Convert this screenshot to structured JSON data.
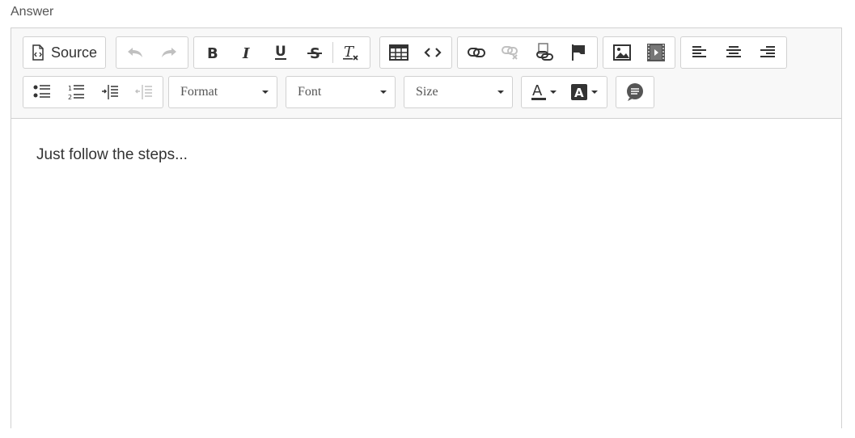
{
  "field": {
    "label": "Answer"
  },
  "toolbar": {
    "source_label": "Source",
    "buttons": {
      "source": "source-icon",
      "undo": "undo-icon",
      "redo": "redo-icon",
      "bold": "bold-icon",
      "italic": "italic-icon",
      "underline": "underline-icon",
      "strikethrough": "strikethrough-icon",
      "remove_format": "remove-format-icon",
      "table": "table-icon",
      "code": "code-icon",
      "link": "link-icon",
      "unlink": "unlink-icon",
      "anchor_link": "anchor-icon",
      "flag": "flag-icon",
      "image": "image-icon",
      "video": "video-icon",
      "align_left": "align-left-icon",
      "align_center": "align-center-icon",
      "align_right": "align-right-icon",
      "bulleted_list": "bulleted-list-icon",
      "numbered_list": "numbered-list-icon",
      "indent": "indent-icon",
      "outdent": "outdent-icon",
      "text_color": "text-color-icon",
      "background_color": "background-color-icon",
      "comment": "comment-icon"
    },
    "format_label": "Format",
    "font_label": "Font",
    "size_label": "Size"
  },
  "content": {
    "text": "Just follow the steps..."
  },
  "colors": {
    "toolbar_bg": "#f8f8f8",
    "border": "#d1d1d1",
    "icon": "#333333"
  }
}
